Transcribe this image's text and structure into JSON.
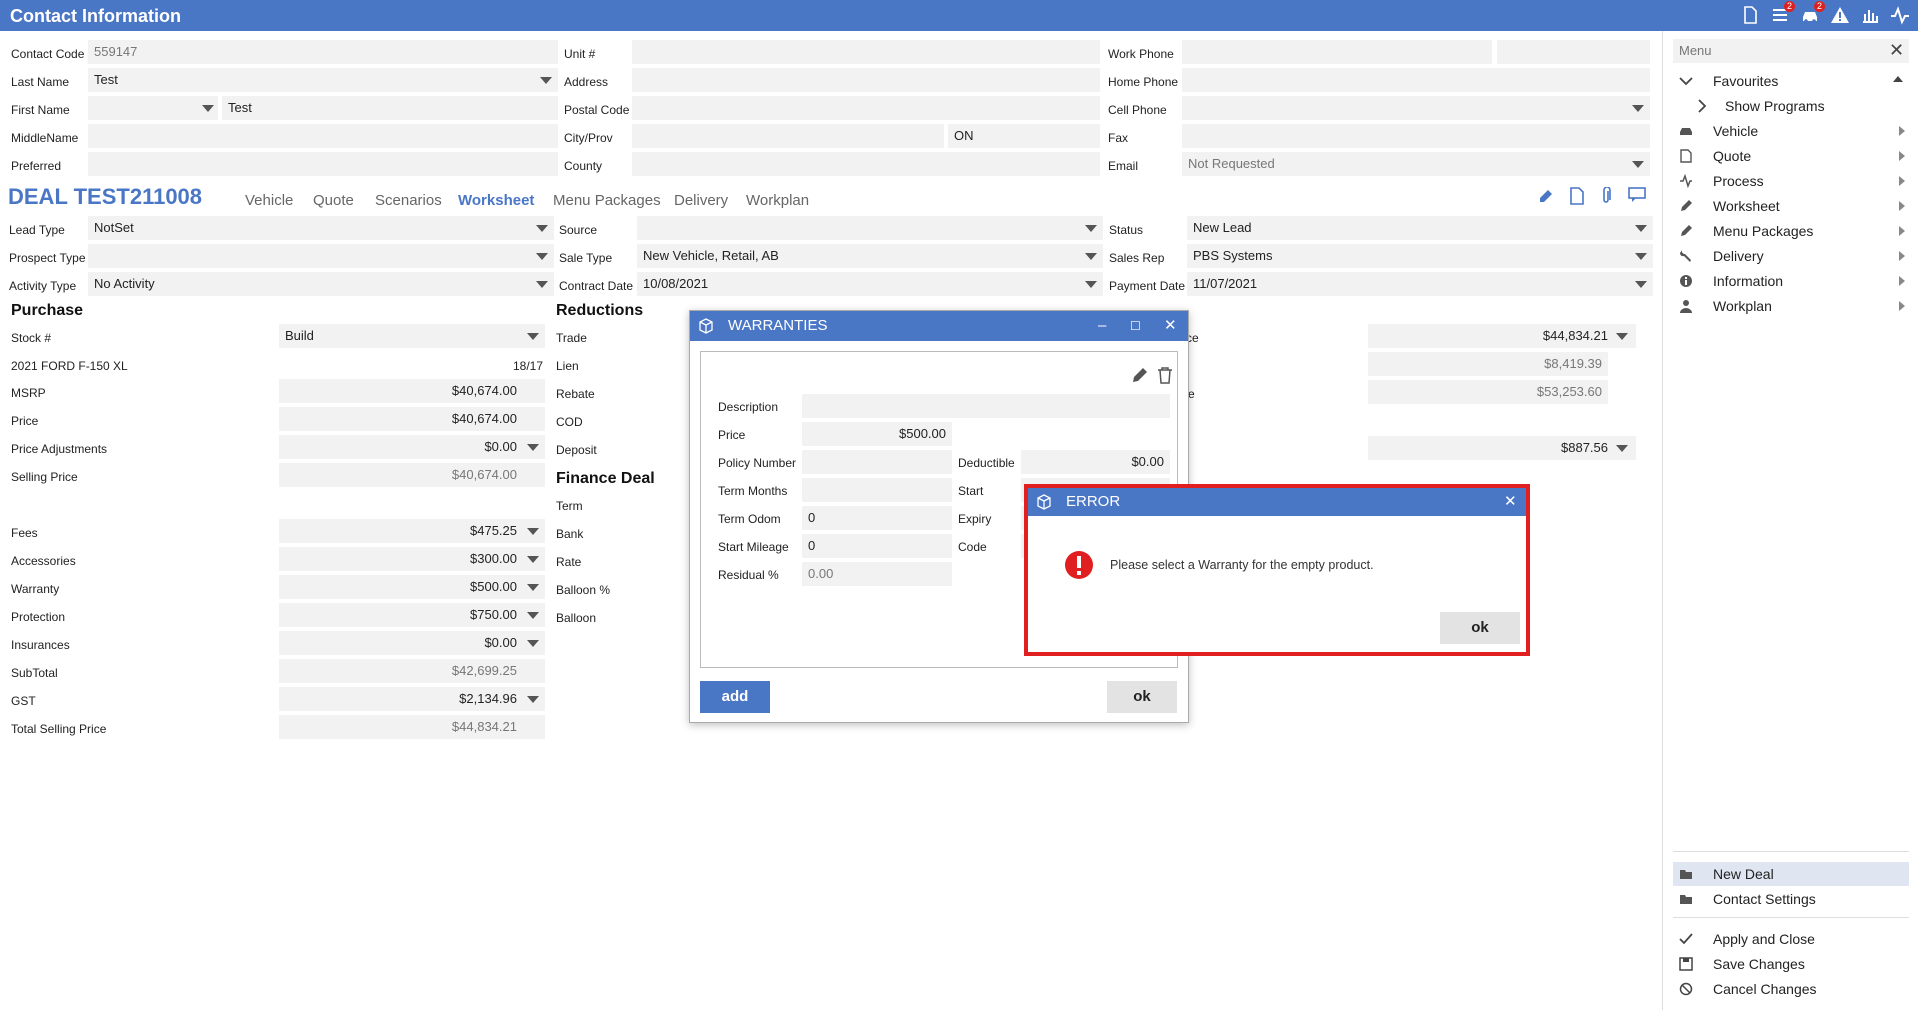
{
  "window": {
    "title": "Contact Information"
  },
  "contact": {
    "contact_code_label": "Contact Code",
    "contact_code": "559147",
    "last_name_label": "Last Name",
    "last_name": "Test",
    "first_name_label": "First Name",
    "first_name": "Test",
    "middle_name_label": "MiddleName",
    "preferred_label": "Preferred",
    "unit_label": "Unit #",
    "address_label": "Address",
    "postal_label": "Postal Code",
    "city_label": "City/Prov",
    "province": "ON",
    "county_label": "County",
    "work_phone_label": "Work Phone",
    "home_phone_label": "Home Phone",
    "cell_phone_label": "Cell Phone",
    "fax_label": "Fax",
    "email_label": "Email",
    "email": "Not Requested"
  },
  "deal": {
    "title": "DEAL TEST211008",
    "tabs": [
      "Vehicle",
      "Quote",
      "Scenarios",
      "Worksheet",
      "Menu Packages",
      "Delivery",
      "Workplan"
    ],
    "active_tab": "Worksheet",
    "lead_type_label": "Lead Type",
    "lead_type": "NotSet",
    "prospect_type_label": "Prospect Type",
    "activity_type_label": "Activity Type",
    "activity_type": "No Activity",
    "source_label": "Source",
    "sale_type_label": "Sale Type",
    "sale_type": "New Vehicle, Retail, AB",
    "contract_date_label": "Contract Date",
    "contract_date": "10/08/2021",
    "status_label": "Status",
    "status": "New Lead",
    "sales_rep_label": "Sales Rep",
    "sales_rep": "PBS Systems",
    "payment_date_label": "Payment Date",
    "payment_date": "11/07/2021"
  },
  "purchase": {
    "heading": "Purchase",
    "stock_label": "Stock #",
    "stock": "Build",
    "vehicle": "2021 FORD F-150 XL",
    "vehicle_code": "18/17",
    "msrp_label": "MSRP",
    "msrp": "$40,674.00",
    "price_label": "Price",
    "price": "$40,674.00",
    "adjust_label": "Price Adjustments",
    "adjust": "$0.00",
    "selling_label": "Selling Price",
    "selling": "$40,674.00",
    "fees_label": "Fees",
    "fees": "$475.25",
    "accessories_label": "Accessories",
    "accessories": "$300.00",
    "warranty_label": "Warranty",
    "warranty": "$500.00",
    "protection_label": "Protection",
    "protection": "$750.00",
    "insurances_label": "Insurances",
    "insurances": "$0.00",
    "subtotal_label": "SubTotal",
    "subtotal": "$42,699.25",
    "gst_label": "GST",
    "gst": "$2,134.96",
    "total_label": "Total Selling Price",
    "total": "$44,834.21"
  },
  "reductions": {
    "heading": "Reductions",
    "trade": "Trade",
    "lien": "Lien",
    "rebate": "Rebate",
    "cod": "COD",
    "deposit": "Deposit",
    "finance_heading": "Finance Deal",
    "term": "Term",
    "bank": "Bank",
    "rate": "Rate",
    "balloon_pct": "Balloon %",
    "balloon": "Balloon"
  },
  "right_values": {
    "label_partial_1": "ce",
    "label_partial_2": "e",
    "v1": "$44,834.21",
    "v2": "$8,419.39",
    "v3": "$53,253.60",
    "v4": "$887.56"
  },
  "warranties": {
    "title": "WARRANTIES",
    "description_label": "Description",
    "price_label": "Price",
    "price": "$500.00",
    "policy_label": "Policy Number",
    "deductible_label": "Deductible",
    "deductible": "$0.00",
    "term_months_label": "Term Months",
    "start_label": "Start",
    "term_odom_label": "Term Odom",
    "term_odom": "0",
    "expiry_label": "Expiry",
    "start_mileage_label": "Start Mileage",
    "start_mileage": "0",
    "code_label": "Code",
    "residual_label": "Residual %",
    "residual": "0.00",
    "add_label": "add",
    "ok_label": "ok"
  },
  "error": {
    "title": "ERROR",
    "message": "Please select a Warranty for the empty product.",
    "ok_label": "ok"
  },
  "sidebar": {
    "search_placeholder": "Menu",
    "favourites": "Favourites",
    "show_programs": "Show Programs",
    "items": [
      "Vehicle",
      "Quote",
      "Process",
      "Worksheet",
      "Menu Packages",
      "Delivery",
      "Information",
      "Workplan"
    ],
    "new_deal": "New Deal",
    "contact_settings": "Contact Settings",
    "apply_close": "Apply and Close",
    "save_changes": "Save Changes",
    "cancel_changes": "Cancel Changes"
  },
  "badges": {
    "list_count": "2",
    "car_count": "2"
  },
  "colors": {
    "accent": "#4a76c6",
    "error_border": "#e02020"
  }
}
